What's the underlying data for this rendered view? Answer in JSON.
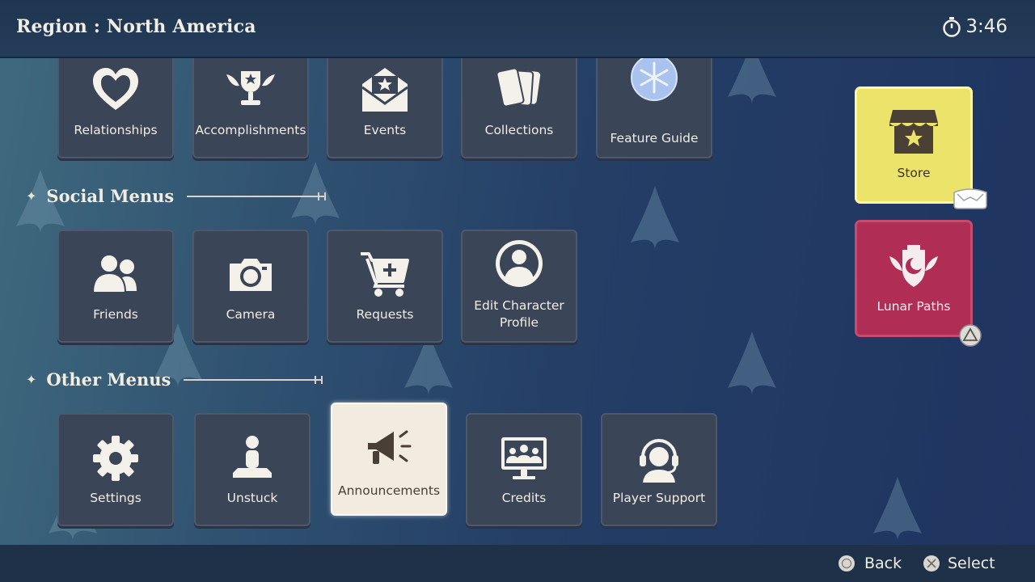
{
  "header": {
    "region_label": "Region : North America",
    "time": "3:46"
  },
  "top_row": [
    {
      "label": "Relationships",
      "icon": "heart-icon"
    },
    {
      "label": "Accomplishments",
      "icon": "trophy-icon"
    },
    {
      "label": "Events",
      "icon": "envelope-star-icon"
    },
    {
      "label": "Collections",
      "icon": "cards-icon"
    },
    {
      "label": "Feature Guide",
      "icon": "snowflake-orb-icon"
    }
  ],
  "social": {
    "title": "Social Menus",
    "items": [
      {
        "label": "Friends",
        "icon": "friends-icon"
      },
      {
        "label": "Camera",
        "icon": "camera-icon"
      },
      {
        "label": "Requests",
        "icon": "cart-plus-icon"
      },
      {
        "label": "Edit Character Profile",
        "icon": "profile-icon"
      }
    ]
  },
  "other": {
    "title": "Other Menus",
    "items": [
      {
        "label": "Settings",
        "icon": "gear-icon"
      },
      {
        "label": "Unstuck",
        "icon": "person-pin-icon"
      },
      {
        "label": "Announcements",
        "icon": "megaphone-icon",
        "selected": true
      },
      {
        "label": "Credits",
        "icon": "monitor-people-icon"
      },
      {
        "label": "Player Support",
        "icon": "headset-icon"
      }
    ]
  },
  "side": {
    "store_label": "Store",
    "lunar_label": "Lunar Paths"
  },
  "footer": {
    "back_label": "Back",
    "select_label": "Select"
  },
  "colors": {
    "store": "#ece46a",
    "lunar": "#b02e55",
    "tile": "#3b4558",
    "selected_tile": "#f2ece0"
  }
}
